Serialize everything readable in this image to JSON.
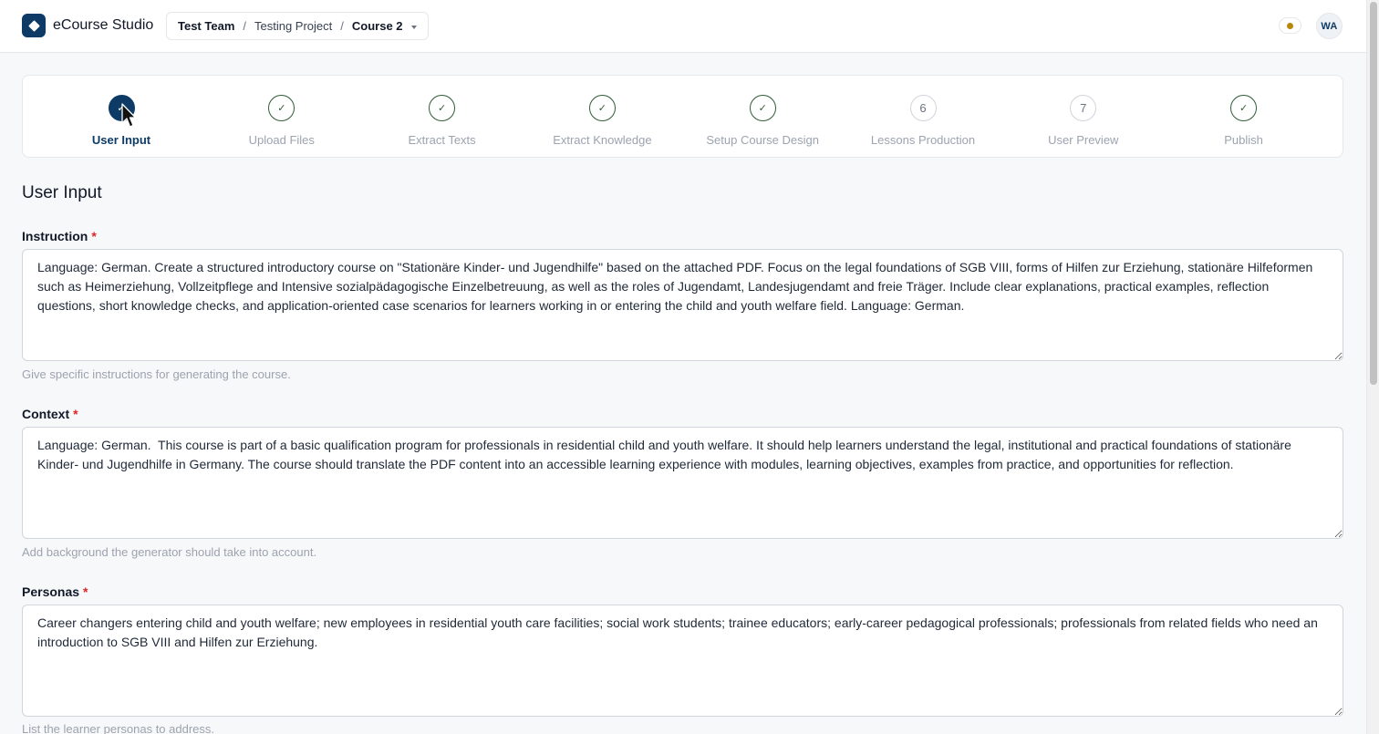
{
  "header": {
    "app_name": "eCourse Studio",
    "breadcrumb": {
      "team": "Test Team",
      "project": "Testing Project",
      "course": "Course 2",
      "separator": "/"
    },
    "avatar_initials": "WA",
    "status_color": "#b8860b"
  },
  "stepper": {
    "steps": [
      {
        "label": "User Input",
        "state": "active",
        "marker": "✓"
      },
      {
        "label": "Upload Files",
        "state": "done",
        "marker": "✓"
      },
      {
        "label": "Extract Texts",
        "state": "done",
        "marker": "✓"
      },
      {
        "label": "Extract Knowledge",
        "state": "done",
        "marker": "✓"
      },
      {
        "label": "Setup Course Design",
        "state": "done",
        "marker": "✓"
      },
      {
        "label": "Lessons Production",
        "state": "pending",
        "marker": "6"
      },
      {
        "label": "User Preview",
        "state": "pending",
        "marker": "7"
      },
      {
        "label": "Publish",
        "state": "done",
        "marker": "✓"
      }
    ]
  },
  "form": {
    "title": "User Input",
    "required_marker": "*",
    "instruction": {
      "label": "Instruction",
      "value": "Language: German. Create a structured introductory course on \"Stationäre Kinder- und Jugendhilfe\" based on the attached PDF. Focus on the legal foundations of SGB VIII, forms of Hilfen zur Erziehung, stationäre Hilfeformen such as Heimerziehung, Vollzeitpflege and Intensive sozialpädagogische Einzelbetreuung, as well as the roles of Jugendamt, Landesjugendamt and freie Träger. Include clear explanations, practical examples, reflection questions, short knowledge checks, and application-oriented case scenarios for learners working in or entering the child and youth welfare field. Language: German.",
      "helper": "Give specific instructions for generating the course."
    },
    "context": {
      "label": "Context",
      "value": "Language: German.  This course is part of a basic qualification program for professionals in residential child and youth welfare. It should help learners understand the legal, institutional and practical foundations of stationäre Kinder- und Jugendhilfe in Germany. The course should translate the PDF content into an accessible learning experience with modules, learning objectives, examples from practice, and opportunities for reflection.",
      "helper": "Add background the generator should take into account."
    },
    "personas": {
      "label": "Personas",
      "value": "Career changers entering child and youth welfare; new employees in residential youth care facilities; social work students; trainee educators; early-career pedagogical professionals; professionals from related fields who need an introduction to SGB VIII and Hilfen zur Erziehung.",
      "helper": "List the learner personas to address."
    }
  },
  "colors": {
    "brand": "#0d3b66",
    "done": "#2f5d3a",
    "required": "#dc2626"
  }
}
